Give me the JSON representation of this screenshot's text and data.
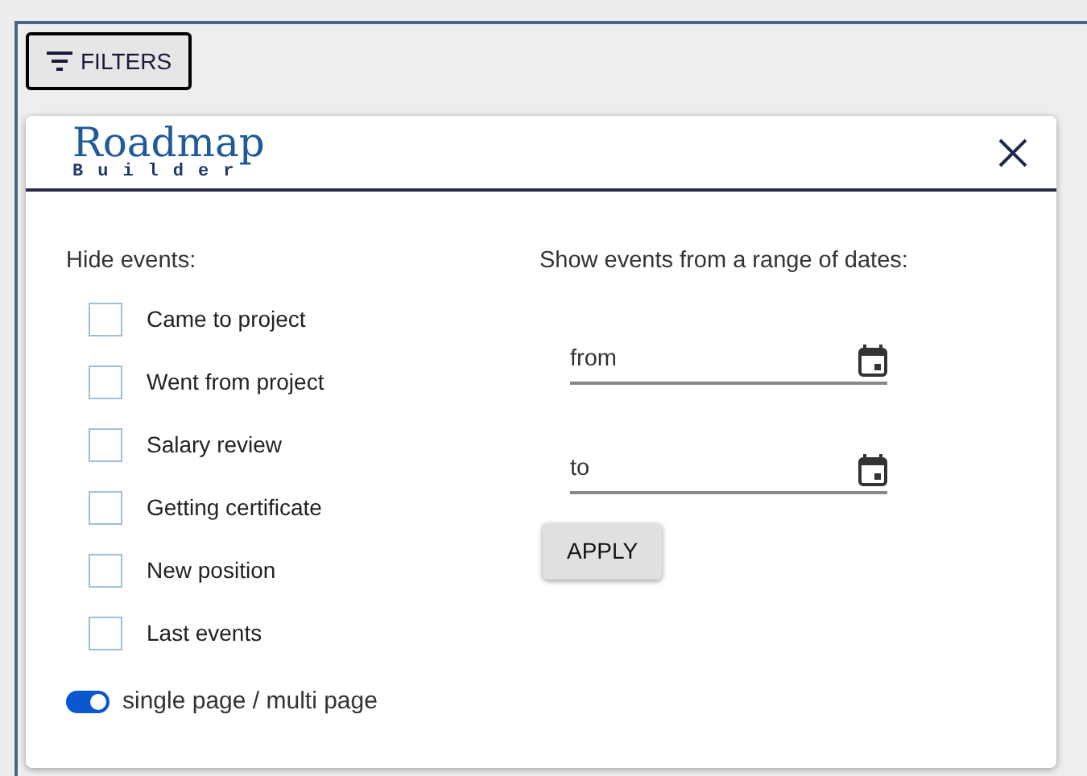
{
  "filters_button": {
    "label": "FILTERS"
  },
  "dialog": {
    "logo": {
      "title": "Roadmap",
      "subtitle": "Builder"
    },
    "hide_events": {
      "heading": "Hide events:",
      "items": [
        {
          "label": "Came to project",
          "checked": false
        },
        {
          "label": "Went from project",
          "checked": false
        },
        {
          "label": "Salary review",
          "checked": false
        },
        {
          "label": "Getting certificate",
          "checked": false
        },
        {
          "label": "New position",
          "checked": false
        },
        {
          "label": "Last events",
          "checked": false
        }
      ]
    },
    "toggle": {
      "label": "single page / multi page",
      "on": true
    },
    "date_range": {
      "heading": "Show events from a range of dates:",
      "fields": [
        {
          "placeholder": "from"
        },
        {
          "placeholder": "to"
        }
      ],
      "apply_button": "APPLY"
    }
  }
}
